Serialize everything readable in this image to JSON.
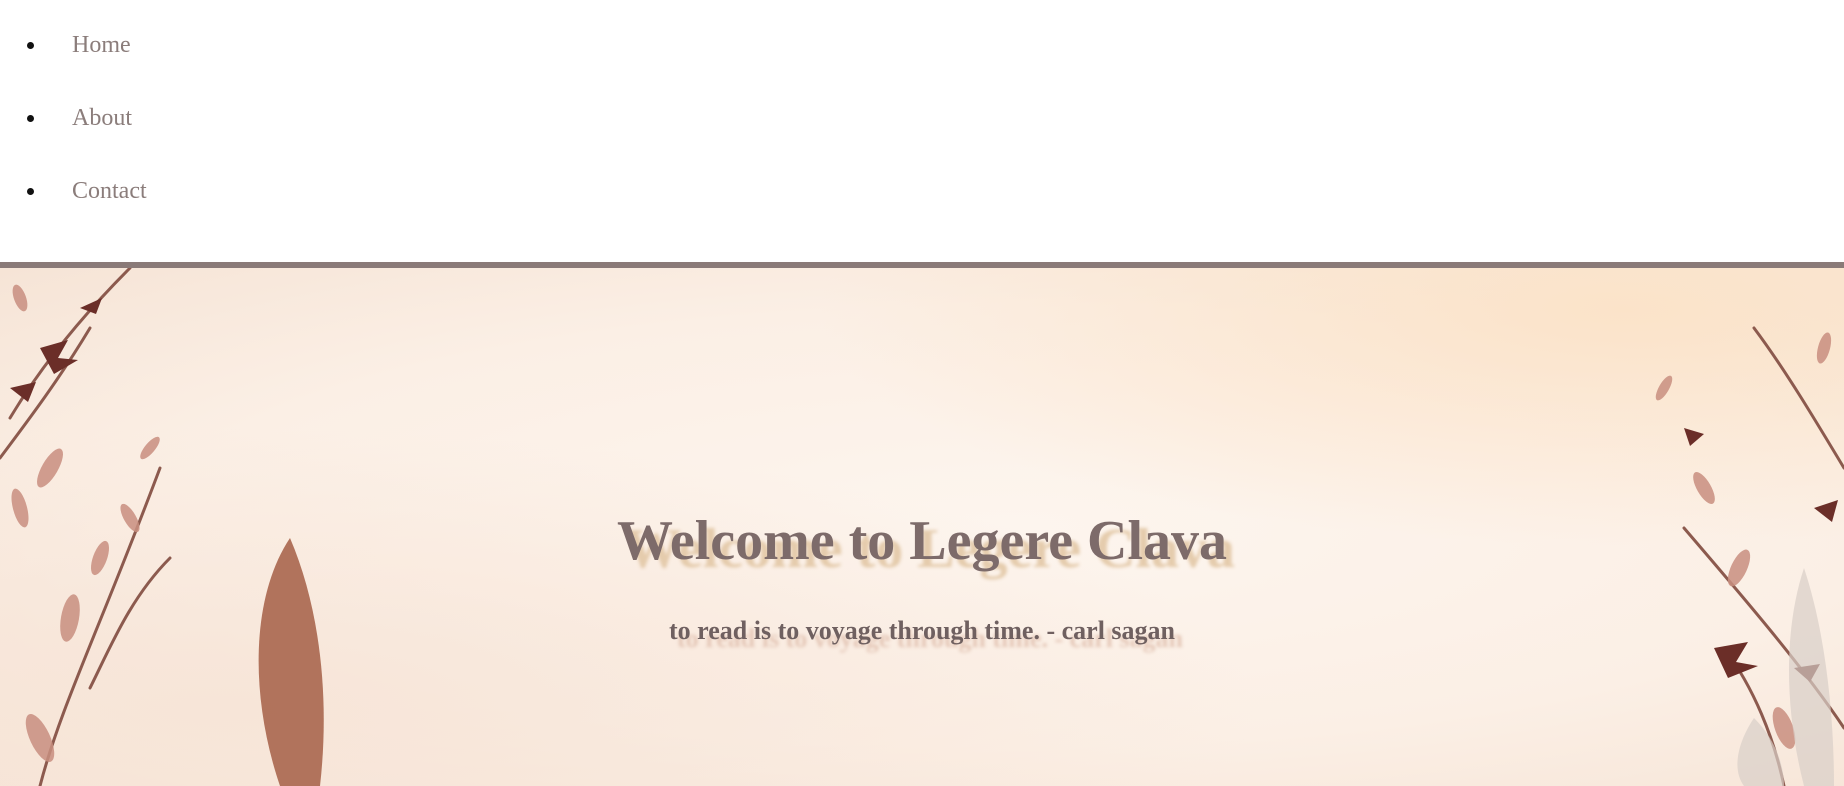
{
  "nav": {
    "items": [
      {
        "label": "Home"
      },
      {
        "label": "About"
      },
      {
        "label": "Contact"
      }
    ]
  },
  "hero": {
    "title": "Welcome to Legere Clava",
    "quote": "to read is to voyage through time. - carl sagan"
  },
  "colors": {
    "accent": "#7d6b6a",
    "nav_text": "#8b7d7b",
    "divider": "#8a7a78",
    "hero_background": "#fbefe5",
    "shadow_gold": "#e2c8a6"
  },
  "icons": {
    "bullet": "bullet-dot-icon",
    "decoration": "watercolor-botanical-icon"
  }
}
